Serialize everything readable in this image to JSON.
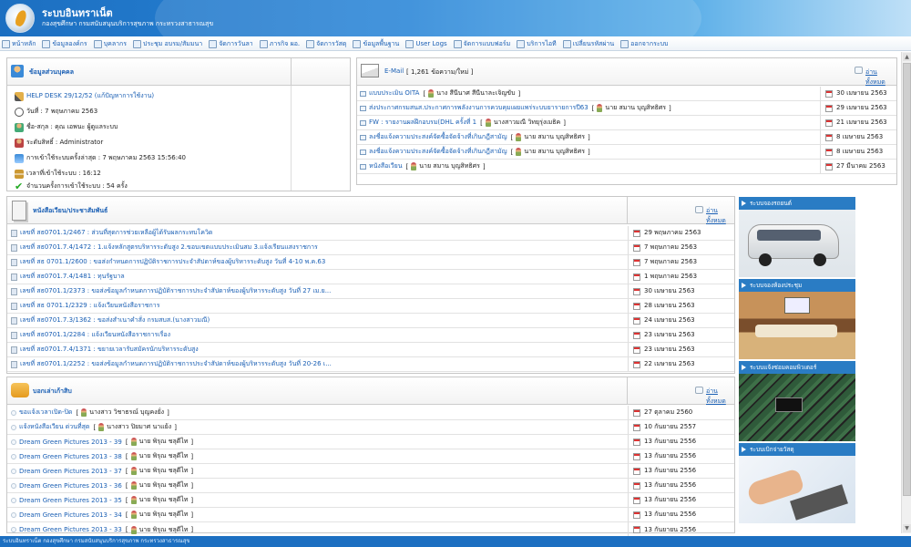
{
  "header": {
    "title": "ระบบอินทราเน็ต",
    "subtitle": "กองสุขศึกษา กรมสนับสนุนบริการสุขภาพ กระทรวงสาธารณสุข"
  },
  "menu": [
    {
      "label": "หน้าหลัก",
      "icon": "home-icon"
    },
    {
      "label": "ข้อมูลองค์กร",
      "icon": "building-icon"
    },
    {
      "label": "บุคลากร",
      "icon": "people-icon"
    },
    {
      "label": "ประชุม อบรม/สัมมนา",
      "icon": "meeting-icon"
    },
    {
      "label": "จัดการวันลา",
      "icon": "calendar-icon"
    },
    {
      "label": "ภารกิจ ผอ.",
      "icon": "task-icon"
    },
    {
      "label": "จัดการวัสดุ",
      "icon": "box-icon"
    },
    {
      "label": "ข้อมูลพื้นฐาน",
      "icon": "database-icon"
    },
    {
      "label": "User Logs",
      "icon": "log-icon"
    },
    {
      "label": "จัดการแบบฟอร์ม",
      "icon": "form-icon"
    },
    {
      "label": "บริการไอที",
      "icon": "computer-icon"
    },
    {
      "label": "เปลี่ยนรหัสผ่าน",
      "icon": "key-icon"
    },
    {
      "label": "ออกจากระบบ",
      "icon": "logout-icon"
    }
  ],
  "personal": {
    "title": "ข้อมูลส่วนบุคคล",
    "helpdesk": "HELP DESK 29/12/52 (แก้ปัญหาการใช้งาน)",
    "date": "วันที่ : 7 พฤษภาคม 2563",
    "name": "ชื่อ-สกุล : คุณ เอพนะ ผู้ดูแลระบบ",
    "level": "ระดับสิทธิ์ : Administrator",
    "last_login": "การเข้าใช้ระบบครั้งล่าสุด : 7 พฤษภาคม 2563  15:56:40",
    "login_time": "เวลาที่เข้าใช้ระบบ : 16:12",
    "login_count": "จำนวนครั้งการเข้าใช้ระบบ : 54 ครั้ง"
  },
  "email": {
    "title": "E-Mail",
    "count": "[ 1,261 ข้อความ/ใหม่ ]",
    "read_all": "อ่านทั้งหมด",
    "items": [
      {
        "subject": "แบบประเมิน OITA",
        "sender": "นาง สีนีนาศ สีนีนาละเจิญขับ",
        "date": "30 เมษายน 2563"
      },
      {
        "subject": "ส่งประกาศกรมสนส.ประกาศการพลังงานการควบคุมเผยแพร่ระบบยารายการปี63",
        "sender": "นาย สมาน บุญสิทธิศร",
        "date": "29 เมษายน 2563"
      },
      {
        "subject": "FW : รายงานผลฝึกอบรม(DHL ครั้งที่ 1",
        "sender": "นางสาวมณี วิทยุรุ่งเมธิค",
        "date": "21 เมษายน 2563"
      },
      {
        "subject": "ลงชื่อแจ้งความประสงค์จัดซื้อจัดจ้างที่เกินกฎีสามัญ",
        "sender": "นาย สมาน บุญสิทธิศร",
        "date": "8 เมษายน 2563"
      },
      {
        "subject": "ลงชื่อแจ้งความประสงค์จัดซื้อจัดจ้างที่เกินกฎีสามัญ",
        "sender": "นาย สมาน บุญสิทธิศร",
        "date": "8 เมษายน 2563"
      },
      {
        "subject": "หนังสือเวียน",
        "sender": "นาย สมาน บุญสิทธิศร",
        "date": "27 มีนาคม 2563"
      }
    ]
  },
  "circulars": {
    "title": "หนังสือเวียน/ประชาสัมพันธ์",
    "read_all": "อ่านทั้งหมด",
    "items": [
      {
        "text": "เลขที่ สธ0701.1/2467 : ส่วนที่สุดการช่วยเหลือผู้ได้รับผลกระทบโควิด",
        "date": "29 พฤษภาคม 2563"
      },
      {
        "text": "เลขที่ สธ0701.7.4/1472 : 1.แจ้งหลักสูตรบริหารระดับสูง 2.ขอบเขตแบบประเมินสม 3.แจ้งเรียนแสงราชการ",
        "date": "7 พฤษภาคม 2563"
      },
      {
        "text": "เลขที่ สธ 0701.1/2600 : ขอส่งกำหนดการปฏิบัติราชการประจำสัปดาห์ของผู้บริหารระดับสูง วันที่ 4-10 พ.ค.63",
        "date": "7 พฤษภาคม 2563"
      },
      {
        "text": "เลขที่ สธ0701.7.4/1481 : ทุนรัฐบาล",
        "date": "1 พฤษภาคม 2563"
      },
      {
        "text": "เลขที่ สธ0701.1/2373 : ขอส่งข้อมูลกำหนดการปฏิบัติราชการประจำสัปดาห์ของผู้บริหารระดับสูง วันที่ 27 เม.ย...",
        "date": "30 เมษายน 2563"
      },
      {
        "text": "เลขที่ สธ 0701.1/2329 : แจ้งเวียนหนังสือราชการ",
        "date": "28 เมษายน 2563"
      },
      {
        "text": "เลขที่ สธ0701.7.3/1362 : ขอส่งสำเนาคำสั่ง กรมสบส.(นางสาวมณี)",
        "date": "24 เมษายน 2563"
      },
      {
        "text": "เลขที่ สธ0701.1/2284 : แจ้งเวียนหนังสือราชการเรื่อง",
        "date": "23 เมษายน 2563"
      },
      {
        "text": "เลขที่ สธ0701.7.4/1371 : ขยายเวลารับสมัครนักบริหารระดับสูง",
        "date": "23 เมษายน 2563"
      },
      {
        "text": "เลขที่ สธ0701.1/2252 : ขอส่งข้อมูลกำหนดการปฏิบัติราชการประจำสัปดาห์ของผู้บริหารระดับสูง วันที่ 20-26 เ...",
        "date": "22 เมษายน 2563"
      }
    ]
  },
  "board": {
    "title": "บอกเล่าเก้าสิบ",
    "read_all": "อ่านทั้งหมด",
    "items": [
      {
        "text": "ขอแจ้งเวลาเปิด-ปิด",
        "person": "นางสาว วิชาธรณ์ บุญคงยั่ง",
        "date": "27 ตุลาคม 2560"
      },
      {
        "text": "แจ้งหนังสือเวียน ด่วนที่สุด",
        "person": "นางสาว ปิยมาศ นาแย้ง",
        "date": "10 กันยายน 2557"
      },
      {
        "text": "Dream Green Pictures 2013 - 39",
        "person": "นาย พิรุณ ชลุดีไท",
        "date": "13 กันยายน 2556"
      },
      {
        "text": "Dream Green Pictures 2013 - 38",
        "person": "นาย พิรุณ ชลุดีไท",
        "date": "13 กันยายน 2556"
      },
      {
        "text": "Dream Green Pictures 2013 - 37",
        "person": "นาย พิรุณ ชลุดีไท",
        "date": "13 กันยายน 2556"
      },
      {
        "text": "Dream Green Pictures 2013 - 36",
        "person": "นาย พิรุณ ชลุดีไท",
        "date": "13 กันยายน 2556"
      },
      {
        "text": "Dream Green Pictures 2013 - 35",
        "person": "นาย พิรุณ ชลุดีไท",
        "date": "13 กันยายน 2556"
      },
      {
        "text": "Dream Green Pictures 2013 - 34",
        "person": "นาย พิรุณ ชลุดีไท",
        "date": "13 กันยายน 2556"
      },
      {
        "text": "Dream Green Pictures 2013 - 33",
        "person": "นาย พิรุณ ชลุดีไท",
        "date": "13 กันยายน 2556"
      }
    ]
  },
  "side": [
    {
      "label": "ระบบจองรถยนต์"
    },
    {
      "label": "ระบบจองห้องประชุม"
    },
    {
      "label": "ระบบแจ้งซ่อมคอมพิวเตอร์"
    },
    {
      "label": "ระบบเบิกจ่ายวัสดุ"
    }
  ],
  "footer": "ระบบอินทราเน็ต กองสุขศึกษา กรมสนับสนุนบริการสุขภาพ กระทรวงสาธารณสุข",
  "colors": {
    "header": "#1c6fc1",
    "link": "#1a5fb4",
    "side_header": "#2a7cc4"
  }
}
